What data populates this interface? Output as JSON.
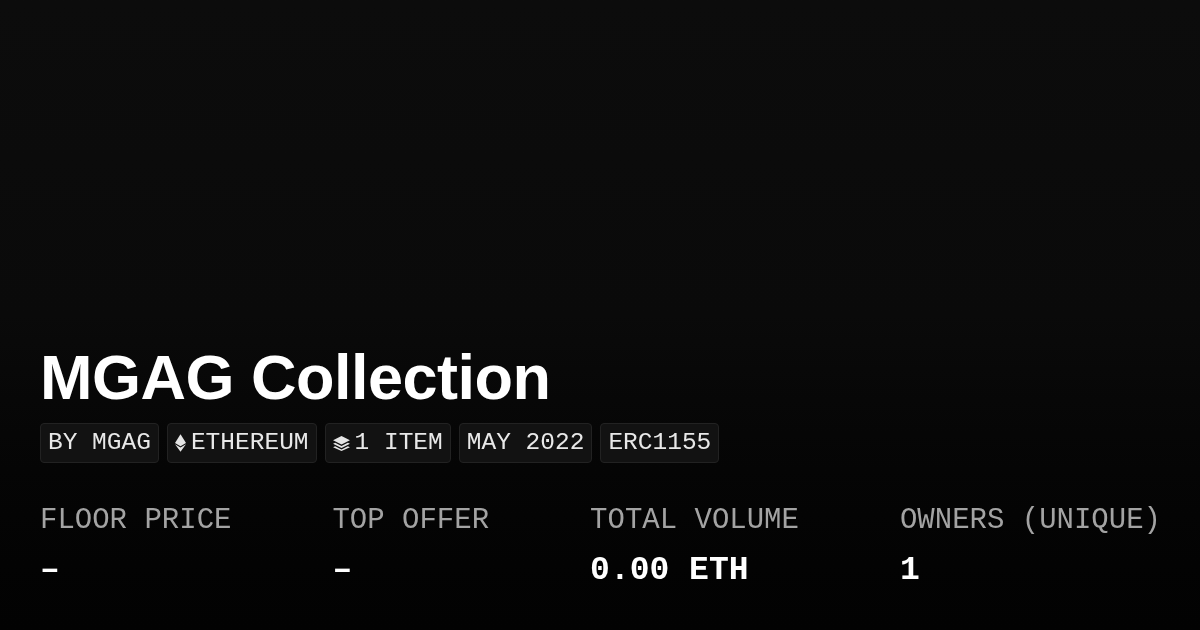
{
  "title": "MGAG Collection",
  "tags": [
    {
      "kind": "text",
      "label": "BY MGAG"
    },
    {
      "kind": "chain",
      "label": "ETHEREUM"
    },
    {
      "kind": "items",
      "label": "1 ITEM"
    },
    {
      "kind": "text",
      "label": "MAY 2022"
    },
    {
      "kind": "text",
      "label": "ERC1155"
    }
  ],
  "stats": [
    {
      "label": "FLOOR PRICE",
      "value": "–"
    },
    {
      "label": "TOP OFFER",
      "value": "–"
    },
    {
      "label": "TOTAL VOLUME",
      "value": "0.00 ETH"
    },
    {
      "label": "OWNERS (UNIQUE)",
      "value": "1"
    }
  ]
}
